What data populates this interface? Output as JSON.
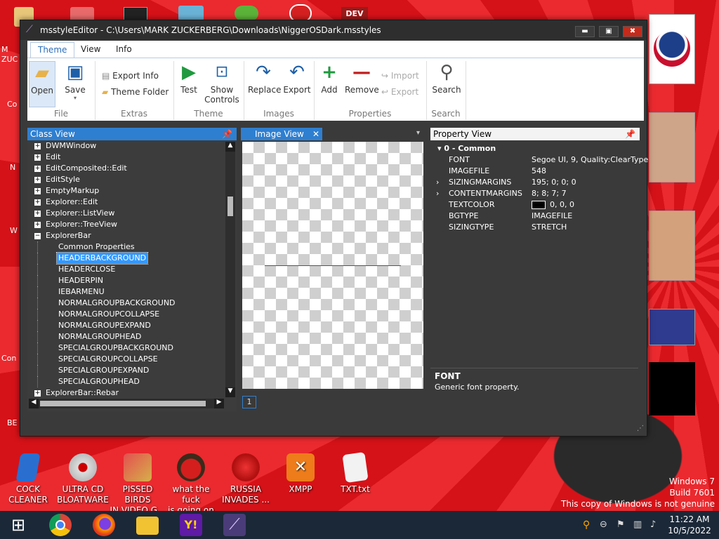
{
  "window": {
    "title": "msstyleEditor - C:\\Users\\MARK ZUCKERBERG\\Downloads\\NiggerOSDark.msstyles",
    "controls": {
      "minimize": "▬",
      "maximize": "▣",
      "close": "✖"
    }
  },
  "ribbon": {
    "tabs": [
      "Theme",
      "View",
      "Info"
    ],
    "file": {
      "open": "Open",
      "save": "Save",
      "group": "File"
    },
    "extras": {
      "export_info": "Export Info",
      "theme_folder": "Theme Folder",
      "group": "Extras"
    },
    "theme": {
      "test": "Test",
      "show_controls_1": "Show",
      "show_controls_2": "Controls",
      "group": "Theme"
    },
    "images": {
      "replace": "Replace",
      "export": "Export",
      "group": "Images"
    },
    "properties": {
      "add": "Add",
      "remove": "Remove",
      "import": "Import",
      "export": "Export",
      "group": "Properties"
    },
    "search": {
      "search": "Search",
      "group": "Search"
    }
  },
  "class_view": {
    "title": "Class View",
    "items": [
      {
        "label": "DWMWindow",
        "kind": "collapsed"
      },
      {
        "label": "Edit",
        "kind": "collapsed"
      },
      {
        "label": "EditComposited::Edit",
        "kind": "collapsed"
      },
      {
        "label": "EditStyle",
        "kind": "collapsed"
      },
      {
        "label": "EmptyMarkup",
        "kind": "collapsed"
      },
      {
        "label": "Explorer::Edit",
        "kind": "collapsed"
      },
      {
        "label": "Explorer::ListView",
        "kind": "collapsed"
      },
      {
        "label": "Explorer::TreeView",
        "kind": "collapsed"
      },
      {
        "label": "ExplorerBar",
        "kind": "expanded"
      },
      {
        "label": "Common Properties",
        "kind": "child"
      },
      {
        "label": "HEADERBACKGROUND",
        "kind": "selected"
      },
      {
        "label": "HEADERCLOSE",
        "kind": "child"
      },
      {
        "label": "HEADERPIN",
        "kind": "child"
      },
      {
        "label": "IEBARMENU",
        "kind": "child"
      },
      {
        "label": "NORMALGROUPBACKGROUND",
        "kind": "child"
      },
      {
        "label": "NORMALGROUPCOLLAPSE",
        "kind": "child"
      },
      {
        "label": "NORMALGROUPEXPAND",
        "kind": "child"
      },
      {
        "label": "NORMALGROUPHEAD",
        "kind": "child"
      },
      {
        "label": "SPECIALGROUPBACKGROUND",
        "kind": "child"
      },
      {
        "label": "SPECIALGROUPCOLLAPSE",
        "kind": "child"
      },
      {
        "label": "SPECIALGROUPEXPAND",
        "kind": "child"
      },
      {
        "label": "SPECIALGROUPHEAD",
        "kind": "child"
      },
      {
        "label": "ExplorerBar::Rebar",
        "kind": "collapsed"
      }
    ]
  },
  "image_view": {
    "tab": "Image View",
    "page": "1"
  },
  "property_view": {
    "title": "Property View",
    "section": "0 - Common",
    "rows": [
      {
        "name": "FONT",
        "value": "Segoe UI, 9, Quality:ClearType",
        "expandable": false
      },
      {
        "name": "IMAGEFILE",
        "value": "548",
        "expandable": false
      },
      {
        "name": "SIZINGMARGINS",
        "value": "195; 0; 0; 0",
        "expandable": true
      },
      {
        "name": "CONTENTMARGINS",
        "value": "8; 8; 7; 7",
        "expandable": true
      },
      {
        "name": "TEXTCOLOR",
        "value": "0, 0, 0",
        "expandable": false,
        "swatch": "#000000"
      },
      {
        "name": "BGTYPE",
        "value": "IMAGEFILE",
        "expandable": false
      },
      {
        "name": "SIZINGTYPE",
        "value": "STRETCH",
        "expandable": false
      }
    ],
    "desc_title": "FONT",
    "desc_text": "Generic font property."
  },
  "desktop": {
    "icons": [
      {
        "label1": "COCK",
        "label2": "CLEANER",
        "color": "#2a6fd0"
      },
      {
        "label1": "ULTRA CD",
        "label2": "BLOATWARE",
        "color": "#c8c8c8"
      },
      {
        "label1": "PISSED BIRDS",
        "label2": "IN VIDEO G...",
        "color": "#d6b04a"
      },
      {
        "label1": "what the fuck",
        "label2": "is going on ...",
        "color": "#5a3a2a"
      },
      {
        "label1": "RUSSIA",
        "label2": "INVADES ...",
        "color": "#b01010"
      },
      {
        "label1": "XMPP",
        "label2": "",
        "color": "#ee7c1a"
      },
      {
        "label1": "TXT.txt",
        "label2": "",
        "color": "#e8e8e8"
      }
    ],
    "watermark": [
      "Windows 7",
      "Build 7601",
      "This copy of Windows is not genuine"
    ]
  },
  "taskbar": {
    "time": "11:22 AM",
    "date": "10/5/2022",
    "apps": [
      "windows-start",
      "chrome",
      "firefox",
      "file-explorer",
      "yahoo-messenger",
      "msstyle-editor"
    ]
  },
  "colors": {
    "accent": "#2a6fbd",
    "panel_dark": "#3c3c3c",
    "selection": "#3399ff",
    "desktop_red": "#d8161c"
  }
}
